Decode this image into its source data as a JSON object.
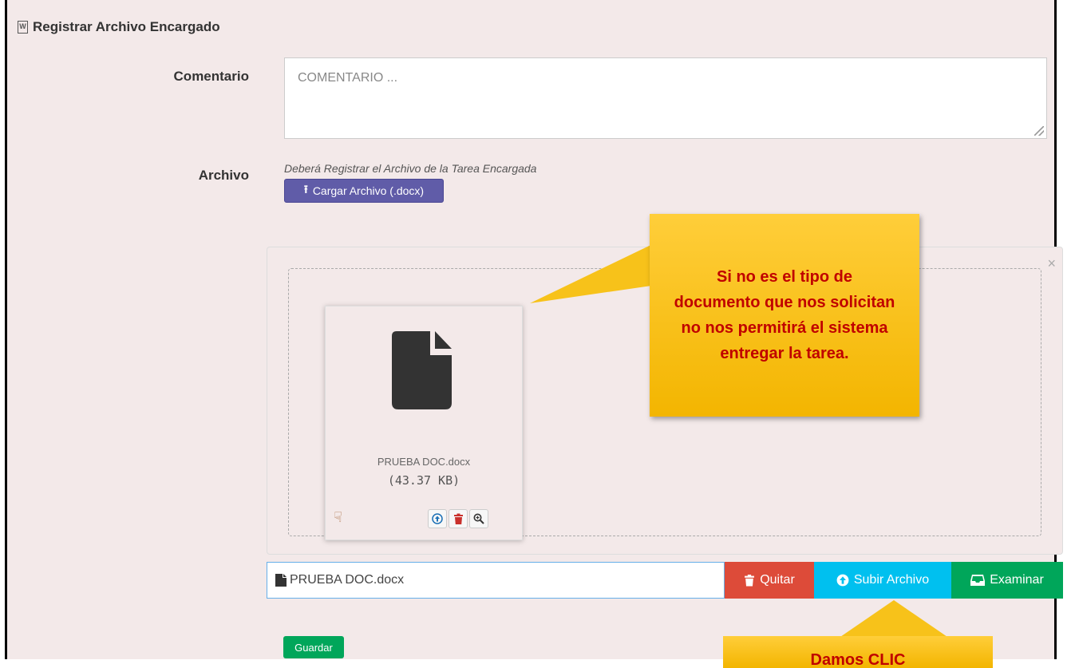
{
  "section": {
    "title": "Registrar Archivo Encargado",
    "title_icon": "word-document-icon"
  },
  "form": {
    "comentario_label": "Comentario",
    "comentario_placeholder": "COMENTARIO ...",
    "comentario_value": "",
    "archivo_label": "Archivo",
    "archivo_hint": "Deberá Registrar el Archivo de la Tarea Encargada",
    "cargar_button": "Cargar Archivo (.docx)"
  },
  "preview": {
    "file_name": "PRUEBA DOC.docx",
    "file_size": "(43.37 KB)",
    "close_symbol": "×",
    "icons": [
      "drag-handle-icon",
      "upload-icon",
      "trash-icon",
      "zoom-in-icon"
    ]
  },
  "file_row": {
    "file_name": "PRUEBA DOC.docx",
    "quitar_label": "Quitar",
    "subir_label": "Subir Archivo",
    "examinar_label": "Examinar"
  },
  "actions": {
    "guardar_label": "Guardar"
  },
  "annotations": {
    "callout_text": "Si no es el tipo de documento que nos solicitan no nos permitirá el sistema entregar la tarea.",
    "callout2_text": "Damos CLIC"
  },
  "colors": {
    "background": "#f3e9e9",
    "purple": "#605ca8",
    "danger": "#dd4b39",
    "info": "#00c0ef",
    "success": "#00a65a",
    "callout": "#f3b500",
    "callout_text": "#c00000"
  }
}
